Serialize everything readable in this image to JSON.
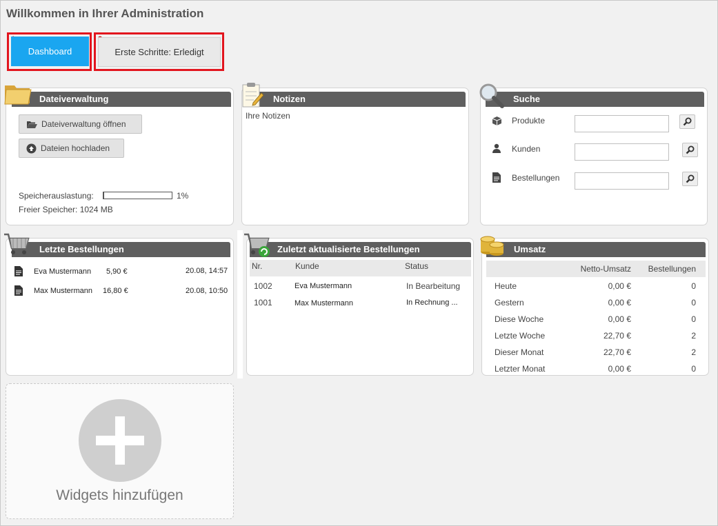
{
  "page": {
    "title": "Willkommen in Ihrer Administration"
  },
  "tabs": [
    {
      "number": "1",
      "label": "Dashboard",
      "active": true
    },
    {
      "number": "2",
      "label": "Erste Schritte: Erledigt",
      "active": false
    }
  ],
  "colors": {
    "accent": "#1aa6f0",
    "header_bar": "#5f5f5f",
    "highlight": "#e2151e"
  },
  "file_widget": {
    "title": "Dateiverwaltung",
    "open_button": "Dateiverwaltung öffnen",
    "upload_button": "Dateien hochladen",
    "storage_label": "Speicherauslastung:",
    "storage_percent": "1%",
    "storage_fraction": 0.01,
    "free_label": "Freier Speicher: 1024 MB"
  },
  "notes_widget": {
    "title": "Notizen",
    "text": "Ihre Notizen"
  },
  "search_widget": {
    "title": "Suche",
    "fields": [
      {
        "label": "Produkte",
        "icon": "cube-icon"
      },
      {
        "label": "Kunden",
        "icon": "user-icon"
      },
      {
        "label": "Bestellungen",
        "icon": "document-icon"
      }
    ]
  },
  "orders_widget": {
    "title": "Letzte Bestellungen",
    "rows": [
      {
        "name": "Eva Mustermann",
        "amount": "5,90 €",
        "date": "20.08, 14:57"
      },
      {
        "name": "Max Mustermann",
        "amount": "16,80 €",
        "date": "20.08, 10:50"
      }
    ]
  },
  "updated_widget": {
    "title": "Zuletzt aktualisierte Bestellungen",
    "columns": [
      "Nr.",
      "Kunde",
      "Status"
    ],
    "rows": [
      {
        "nr": "1002",
        "customer": "Eva Mustermann",
        "status": "In Bearbeitung"
      },
      {
        "nr": "1001",
        "customer": "Max Mustermann",
        "status": "In Rechnung ..."
      }
    ]
  },
  "revenue_widget": {
    "title": "Umsatz",
    "columns": [
      "Netto-Umsatz",
      "Bestellungen"
    ],
    "rows": [
      {
        "period": "Heute",
        "net": "0,00 €",
        "orders": "0"
      },
      {
        "period": "Gestern",
        "net": "0,00 €",
        "orders": "0"
      },
      {
        "period": "Diese Woche",
        "net": "0,00 €",
        "orders": "0"
      },
      {
        "period": "Letzte Woche",
        "net": "22,70 €",
        "orders": "2"
      },
      {
        "period": "Dieser Monat",
        "net": "22,70 €",
        "orders": "2"
      },
      {
        "period": "Letzter Monat",
        "net": "0,00 €",
        "orders": "0"
      }
    ]
  },
  "add_widget": {
    "label": "Widgets hinzufügen"
  }
}
